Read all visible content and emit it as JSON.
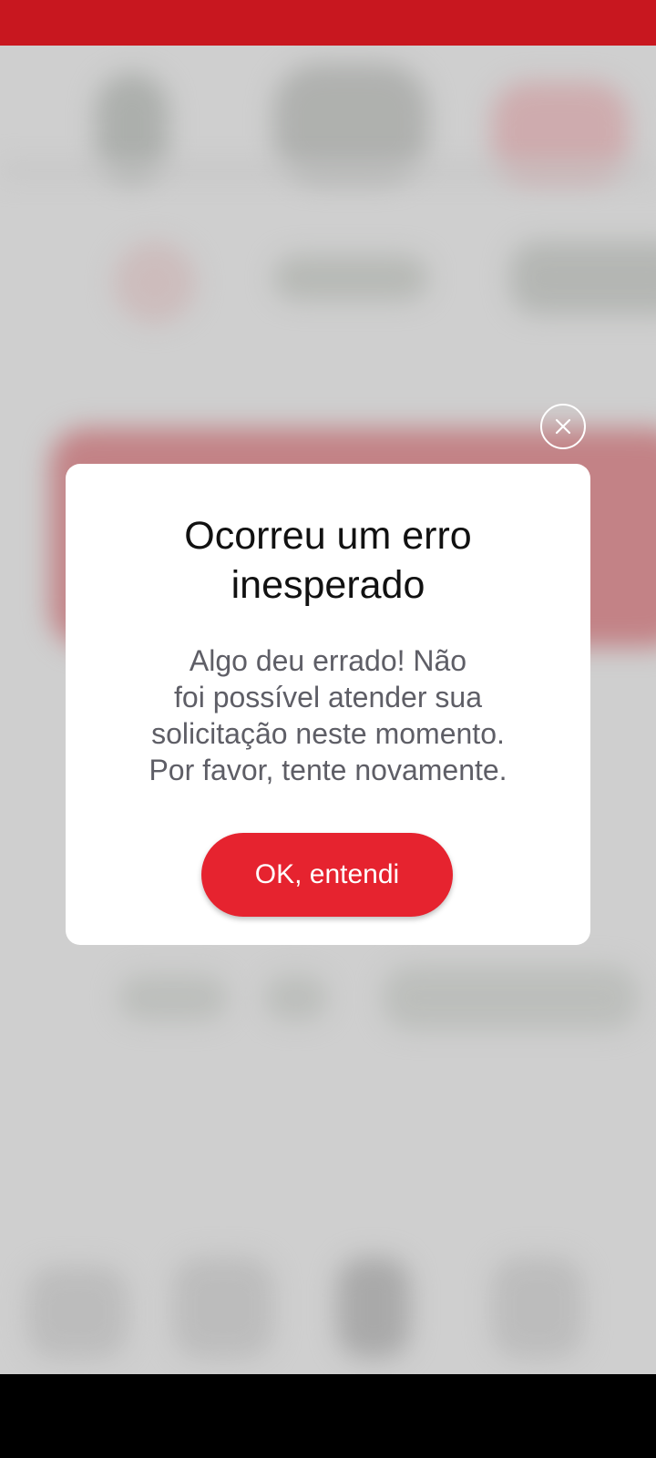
{
  "dialog": {
    "title_lines": [
      "Ocorreu um erro",
      "inesperado"
    ],
    "message_lines": [
      "Algo deu errado! Não",
      "foi possível atender sua",
      "solicitação neste momento.",
      "Por favor, tente novamente."
    ],
    "ok_button_label": "OK, entendi",
    "close_icon": "close-icon"
  },
  "colors": {
    "status_bar": "#c8171f",
    "primary_button": "#e6232f",
    "title_text": "#111111",
    "message_text": "#5e5e66",
    "navigation_bar": "#000000"
  }
}
